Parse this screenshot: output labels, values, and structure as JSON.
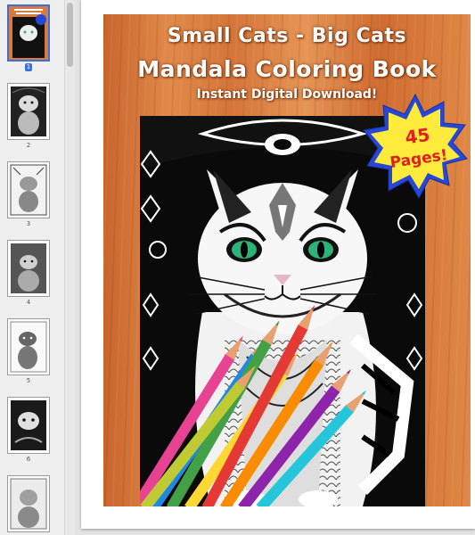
{
  "sidebar": {
    "thumbnails": [
      {
        "number": "1",
        "selected": true
      },
      {
        "number": "2",
        "selected": false
      },
      {
        "number": "3",
        "selected": false
      },
      {
        "number": "4",
        "selected": false
      },
      {
        "number": "5",
        "selected": false
      },
      {
        "number": "6",
        "selected": false
      },
      {
        "number": "",
        "selected": false
      }
    ]
  },
  "cover": {
    "title_line1": "Small Cats - Big Cats",
    "title_line2": "Mandala Coloring Book",
    "subtitle": "Instant Digital Download!",
    "badge_line1": "45",
    "badge_line2": "Pages!"
  },
  "colors": {
    "selection": "#3b6ee0",
    "badge_fill": "#2748d6",
    "badge_text": "#e0201c",
    "eye": "#2db37a"
  }
}
